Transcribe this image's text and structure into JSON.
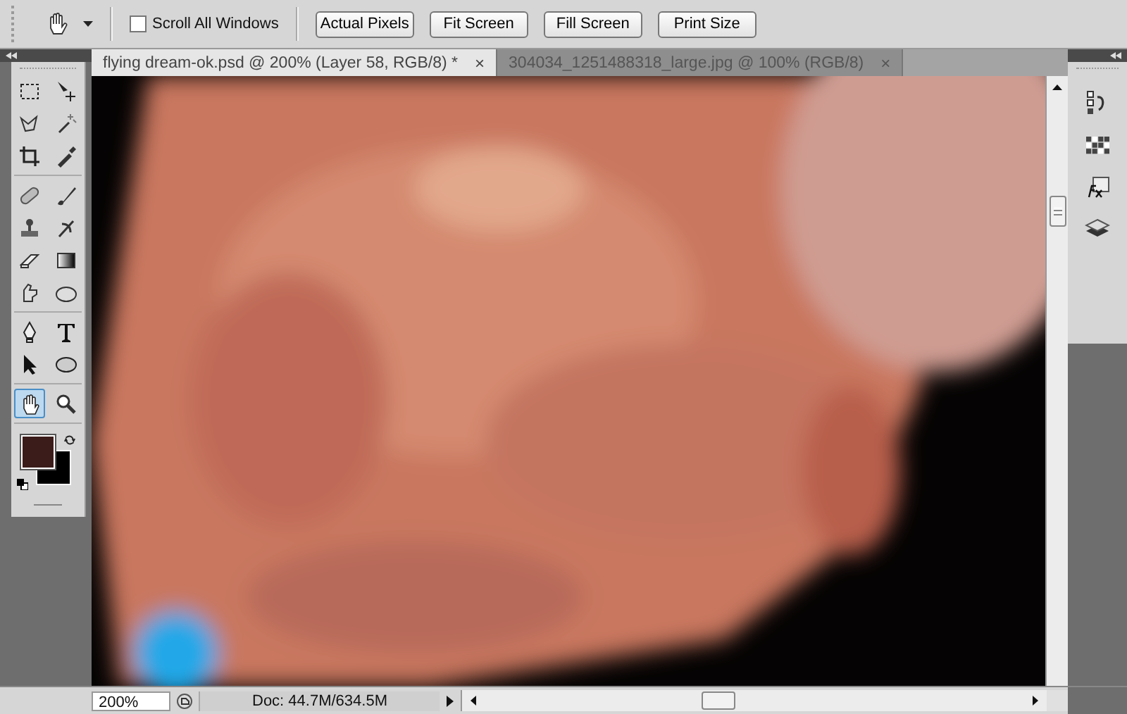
{
  "options_bar": {
    "scroll_all_windows": {
      "label": "Scroll All Windows",
      "checked": false
    },
    "buttons": [
      "Actual Pixels",
      "Fit Screen",
      "Fill Screen",
      "Print Size"
    ]
  },
  "tools": [
    {
      "kind": "marquee",
      "selected": false
    },
    {
      "kind": "move",
      "selected": false
    },
    {
      "kind": "lasso",
      "selected": false
    },
    {
      "kind": "wand",
      "selected": false
    },
    {
      "kind": "crop",
      "selected": false
    },
    {
      "kind": "eyedropper",
      "selected": false
    },
    {
      "kind": "heal",
      "selected": false
    },
    {
      "kind": "brush",
      "selected": false
    },
    {
      "kind": "stamp",
      "selected": false
    },
    {
      "kind": "history",
      "selected": false
    },
    {
      "kind": "eraser",
      "selected": false
    },
    {
      "kind": "gradient",
      "selected": false
    },
    {
      "kind": "smudge",
      "selected": false
    },
    {
      "kind": "sponge",
      "selected": false
    },
    {
      "kind": "pen",
      "selected": false
    },
    {
      "kind": "type",
      "selected": false
    },
    {
      "kind": "select",
      "selected": false
    },
    {
      "kind": "ellipse",
      "selected": false
    },
    {
      "kind": "hand",
      "selected": true
    },
    {
      "kind": "zoom",
      "selected": false
    }
  ],
  "tabs": [
    {
      "label": "flying dream-ok.psd @ 200% (Layer 58, RGB/8) *",
      "close": "×",
      "selected": true
    },
    {
      "label": "304034_1251488318_large.jpg @ 100% (RGB/8)",
      "close": "×",
      "selected": false
    }
  ],
  "status_bar": {
    "zoom": "200%",
    "doc_info": "Doc: 44.7M/634.5M"
  }
}
